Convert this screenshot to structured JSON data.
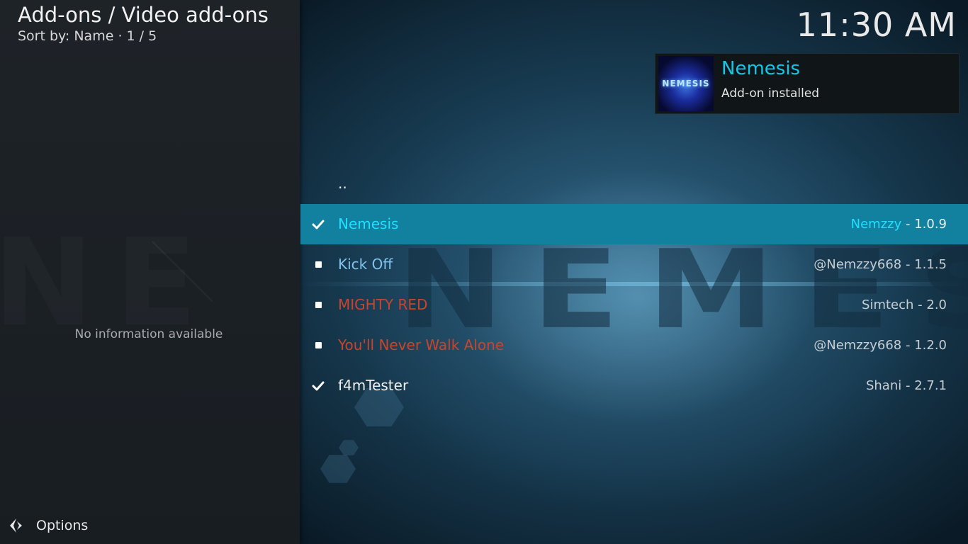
{
  "header": {
    "title": "Add-ons / Video add-ons",
    "sort_info": "Sort by: Name  ·  1 / 5"
  },
  "clock": "11:30 AM",
  "info_panel": {
    "message": "No information available"
  },
  "options": {
    "label": "Options",
    "icon": "options-icon"
  },
  "notification": {
    "title": "Nemesis",
    "subtitle": "Add-on installed",
    "thumbnail_text": "NEMESIS"
  },
  "background_word": "NEMESIS",
  "list": {
    "parent_label": "..",
    "items": [
      {
        "label": "Nemesis",
        "author": "Nemzzy",
        "version": " - 1.0.9",
        "mark": "check",
        "label_color": "#1ee0ff",
        "focused": true
      },
      {
        "label": "Kick Off",
        "author": "@Nemzzy668",
        "version": " - 1.1.5",
        "mark": "dot",
        "label_color": "#7fc4ee",
        "focused": false
      },
      {
        "label": "MIGHTY RED",
        "author": "Simtech",
        "version": " - 2.0",
        "mark": "dot",
        "label_color": "#c8452d",
        "focused": false
      },
      {
        "label": "You'll Never Walk Alone",
        "author": "@Nemzzy668",
        "version": " - 1.2.0",
        "mark": "dot",
        "label_color": "#c8452d",
        "focused": false
      },
      {
        "label": "f4mTester",
        "author": "Shani",
        "version": " - 2.7.1",
        "mark": "check",
        "label_color": "#f0f0f0",
        "focused": false
      }
    ]
  },
  "colors": {
    "accent": "#12c7e8",
    "focus_bar": "#12809f",
    "panel": "#1b2025"
  }
}
